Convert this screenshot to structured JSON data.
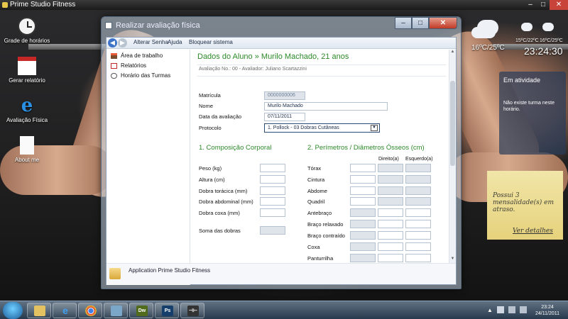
{
  "topbar": {
    "title": "Prime Studio Fitness"
  },
  "desktop_icons": [
    {
      "label": "Grade de horários"
    },
    {
      "label": "Gerar relatório"
    },
    {
      "label": "Avaliação Física"
    },
    {
      "label": "About me"
    }
  ],
  "window": {
    "title": "Realizar avaliação física"
  },
  "menu": {
    "items": [
      "Alterar Senha",
      "Ajuda",
      "Bloquear sistema"
    ]
  },
  "sidebar": {
    "items": [
      {
        "label": "Área de trabalho",
        "icon": "dashboard-icon"
      },
      {
        "label": "Relatórios",
        "icon": "pdf-report-icon"
      },
      {
        "label": "Horário das Turmas",
        "icon": "schedule-icon"
      }
    ]
  },
  "footer": {
    "label": "Application Prime Studio Fitness"
  },
  "header": {
    "title": "Dados do Aluno » Murilo Machado, 21 anos",
    "subtitle": "Avaliação No.: 00 - Avaliador: Juliano Scartazzini"
  },
  "form": {
    "matricula_label": "Matrícula",
    "matricula_value": "0000000006",
    "nome_label": "Nome",
    "nome_value": "Murilo Machado",
    "data_label": "Data da avaliação",
    "data_value": "07/11/2011",
    "protocolo_label": "Protocolo",
    "protocolo_value": "1. Pollock - 03 Dobras Cutâneas"
  },
  "composicao": {
    "title": "1. Composição Corporal",
    "fields": [
      "Peso (kg)",
      "Altura (cm)",
      "Dobra torácica (mm)",
      "Dobra abdominal (mm)",
      "Dobra coxa (mm)"
    ],
    "soma_label": "Soma das dobras"
  },
  "perimetros": {
    "title": "2. Perímetros / Diâmetros Ósseos (cm)",
    "col_direito": "Direito(a)",
    "col_esquerdo": "Esquerdo(a)",
    "rows": [
      {
        "label": "Tórax"
      },
      {
        "label": "Cintura"
      },
      {
        "label": "Abdome"
      },
      {
        "label": "Quadril"
      },
      {
        "label": "Antebraço"
      },
      {
        "label": "Braço relaxado"
      },
      {
        "label": "Braço contraído"
      },
      {
        "label": "Coxa"
      },
      {
        "label": "Panturrilha"
      }
    ]
  },
  "weather": {
    "main_temp": "16ºC/25ºC",
    "day1_temp": "15ºC/22ºC",
    "day2_temp": "16ºC/25ºC",
    "time": "23:24:30"
  },
  "atividade": {
    "title": "Em atividade",
    "body": "Não existe turma neste horário."
  },
  "note": {
    "text": "Possui 3 mensalidade(s) em atraso.",
    "link": "Ver detalhes"
  },
  "tray": {
    "time": "23:24",
    "date": "24/11/2011"
  },
  "taskbar": {
    "apps": [
      "explorer-icon",
      "ie-icon",
      "chrome-icon",
      "users-icon",
      "dreamweaver-icon",
      "photoshop-icon",
      "fitness-app-icon"
    ],
    "dw_label": "Dw",
    "ps_label": "Ps"
  },
  "colors": {
    "accent_green": "#2c8a29",
    "window_frame": "#586a80",
    "note_yellow": "#e6d27c"
  }
}
